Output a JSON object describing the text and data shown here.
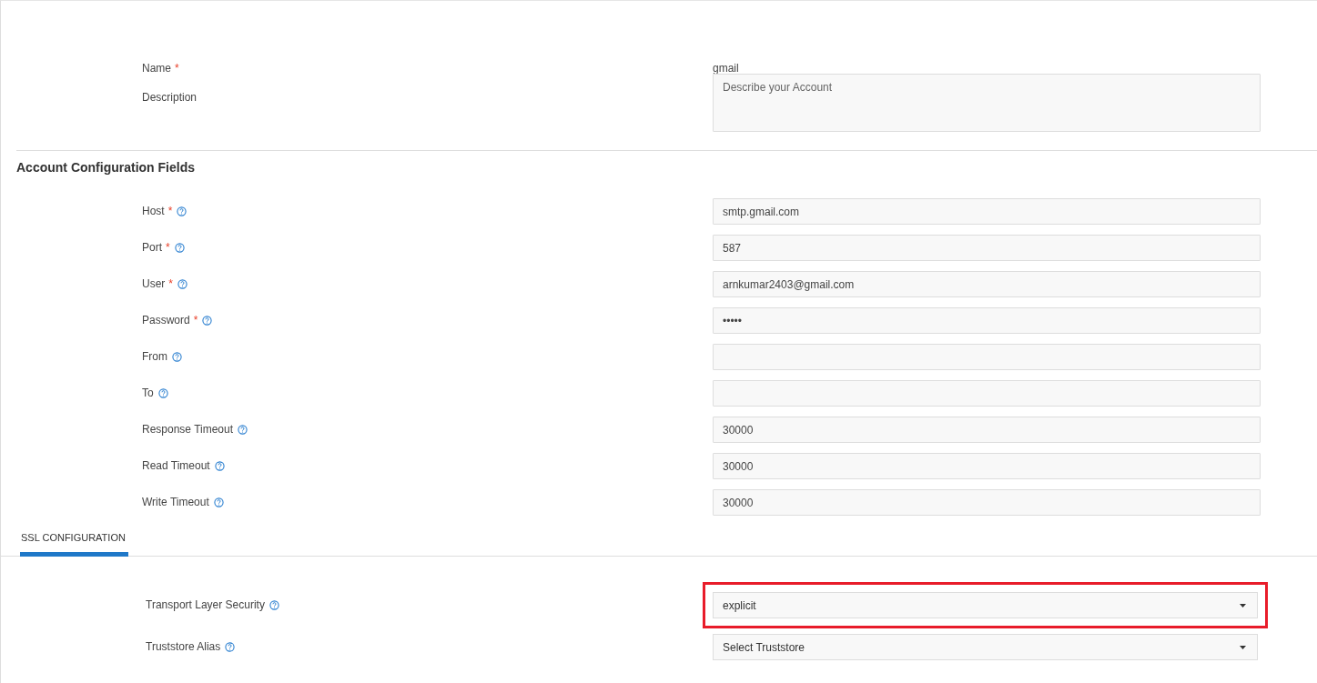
{
  "general": {
    "fields": [
      {
        "label": "Name",
        "required_mark": "*",
        "help": false,
        "kind": "plain",
        "value": "gmail"
      },
      {
        "label": "Description",
        "help": false,
        "kind": "textarea",
        "placeholder": "Describe your Account"
      }
    ]
  },
  "account_configuration": {
    "title": "Account Configuration Fields",
    "fields": [
      {
        "label": "Host",
        "required_mark": "*",
        "help": true,
        "kind": "text",
        "value": "smtp.gmail.com"
      },
      {
        "label": "Port",
        "required_mark": "*",
        "help": true,
        "kind": "text",
        "value": "587"
      },
      {
        "label": "User",
        "required_mark": "*",
        "help": true,
        "kind": "text",
        "value": "arnkumar2403@gmail.com"
      },
      {
        "label": "Password",
        "required_mark": "*",
        "help": true,
        "kind": "text",
        "value": "•••••"
      },
      {
        "label": "From",
        "help": true,
        "kind": "text"
      },
      {
        "label": "To",
        "help": true,
        "kind": "text"
      },
      {
        "label": "Response Timeout",
        "help": true,
        "kind": "text",
        "value": "30000"
      },
      {
        "label": "Read Timeout",
        "help": true,
        "kind": "text",
        "value": "30000"
      },
      {
        "label": "Write Timeout",
        "help": true,
        "kind": "text",
        "value": "30000"
      }
    ]
  },
  "tabs": [
    {
      "label": "SSL CONFIGURATION",
      "selected": true
    }
  ],
  "ssl_configuration": {
    "fields": [
      {
        "label": "Transport Layer Security",
        "help": true,
        "kind": "select",
        "value": "explicit",
        "highlighted": true
      },
      {
        "label": "Truststore Alias",
        "help": true,
        "kind": "select",
        "value": "Select Truststore",
        "highlighted": false
      }
    ]
  }
}
